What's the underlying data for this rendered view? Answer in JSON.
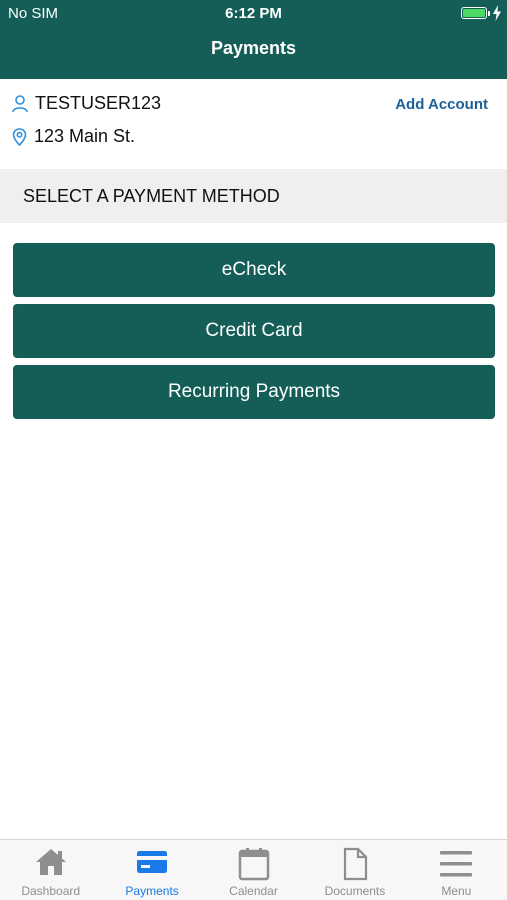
{
  "status_bar": {
    "carrier": "No SIM",
    "time": "6:12 PM",
    "battery_color": "#4cd964"
  },
  "header": {
    "title": "Payments",
    "background_color": "#155e57"
  },
  "account": {
    "username": "TESTUSER123",
    "address": "123 Main St.",
    "add_account_label": "Add Account",
    "user_icon": "user-icon",
    "address_icon": "location-pin-icon"
  },
  "payment_section": {
    "header": "SELECT A PAYMENT METHOD",
    "methods": [
      {
        "label": "eCheck"
      },
      {
        "label": "Credit Card"
      },
      {
        "label": "Recurring Payments"
      }
    ]
  },
  "tab_bar": {
    "active_color": "#1a7be8",
    "inactive_color": "#8e8e8e",
    "tabs": [
      {
        "label": "Dashboard",
        "icon": "home-icon",
        "active": false
      },
      {
        "label": "Payments",
        "icon": "credit-card-icon",
        "active": true
      },
      {
        "label": "Calendar",
        "icon": "calendar-icon",
        "active": false
      },
      {
        "label": "Documents",
        "icon": "document-icon",
        "active": false
      },
      {
        "label": "Menu",
        "icon": "hamburger-menu-icon",
        "active": false
      }
    ]
  }
}
